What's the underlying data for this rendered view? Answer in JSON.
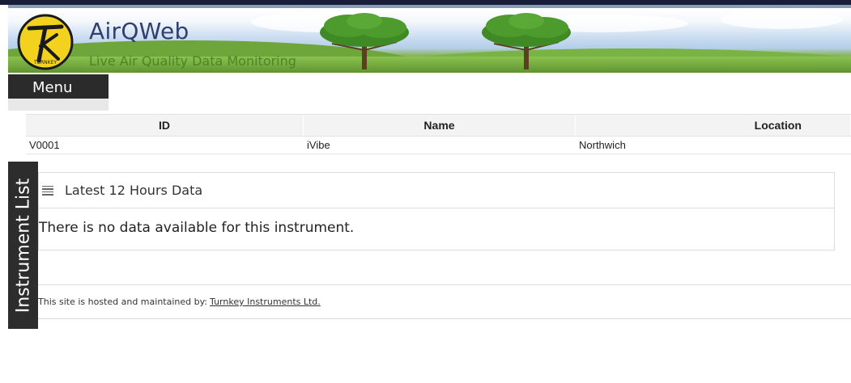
{
  "header": {
    "app_title": "AirQWeb",
    "app_subtitle": "Live Air Quality Data Monitoring",
    "logo_text": "TURNKEY"
  },
  "menu": {
    "label": "Menu"
  },
  "instrument_table": {
    "headers": [
      "ID",
      "Name",
      "Location"
    ],
    "rows": [
      {
        "id": "V0001",
        "name": "iVibe",
        "location": "Northwich"
      }
    ]
  },
  "side_tab": {
    "label": "Instrument List"
  },
  "data_panel": {
    "title": "Latest 12 Hours Data",
    "message": "There is no data available for this instrument."
  },
  "footer": {
    "text": "This site is hosted and maintained by:",
    "link_text": "Turnkey Instruments Ltd."
  },
  "colors": {
    "dark": "#2b2b2b",
    "title_blue": "#2f3f6e",
    "subtitle_green": "#3f7f23",
    "logo_yellow": "#f2d21c"
  }
}
